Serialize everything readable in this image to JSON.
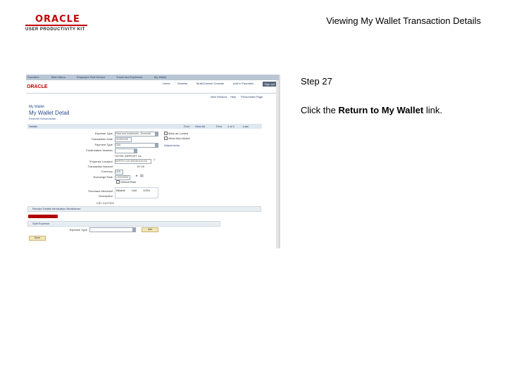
{
  "logo": {
    "brand": "ORACLE",
    "product": "USER PRODUCTIVITY KIT"
  },
  "header": {
    "title": "Viewing My Wallet Transaction Details"
  },
  "step": {
    "label": "Step 27"
  },
  "instruction": {
    "prefix": "Click the ",
    "link_text": "Return to My Wallet",
    "suffix": " link."
  },
  "screenshot": {
    "nav_items": [
      "Favorites",
      "Main Menu",
      "Employee Self-Service",
      "Travel and Expenses",
      "My Wallet"
    ],
    "brand": "ORACLE",
    "top_links": [
      "Home",
      "Worklist",
      "MultiChannel Console",
      "Add to Favorites",
      "Sign out"
    ],
    "sub_links": [
      "New Window",
      "Help",
      "Personalize Page"
    ],
    "page_small_title": "My Wallet",
    "page_title": "My Wallet Detail",
    "page_subtitle": "Kenneth Schumacher",
    "details_label": "Details",
    "details_nav": [
      "Find",
      "View All",
      "First",
      "1 of 1",
      "Last"
    ],
    "fields": [
      {
        "label": "Expense Type",
        "value": "Hotel and Incidentals - Domestic"
      },
      {
        "label": "Transaction Date",
        "value": "10/28/2008"
      },
      {
        "label": "Payment Type",
        "value": "CBA"
      },
      {
        "label": "Confirmation Number",
        "value": ""
      },
      {
        "label": "",
        "value": "HOTEL AIRPORT LA"
      },
      {
        "label": "*Expense Location",
        "value": "NORTH LOS ANGELES/LAX"
      },
      {
        "label": "Transaction Amount",
        "value": "87.00"
      },
      {
        "label": "Currency",
        "value": "USD"
      },
      {
        "label": "Exchange Rate",
        "value": "1.00000000"
      },
      {
        "label": "Purchase Merchant",
        "value": ""
      },
      {
        "label": "Description",
        "value": ""
      }
    ],
    "checkboxes_right": [
      "Mark as Locked",
      "Allow Auto-Match"
    ],
    "attachments_link": "Attachments",
    "default_rate": "Default Rate",
    "description_units": [
      "Billable",
      "Unit"
    ],
    "description_count": "1/254",
    "card_id": "CID: 0147103",
    "receipt_section": "Receipt Details Itemization Breakdown",
    "split_section": "Split Expense",
    "expense_type_label": "Expense Type",
    "add_button": "Add",
    "done_button": "Done"
  }
}
